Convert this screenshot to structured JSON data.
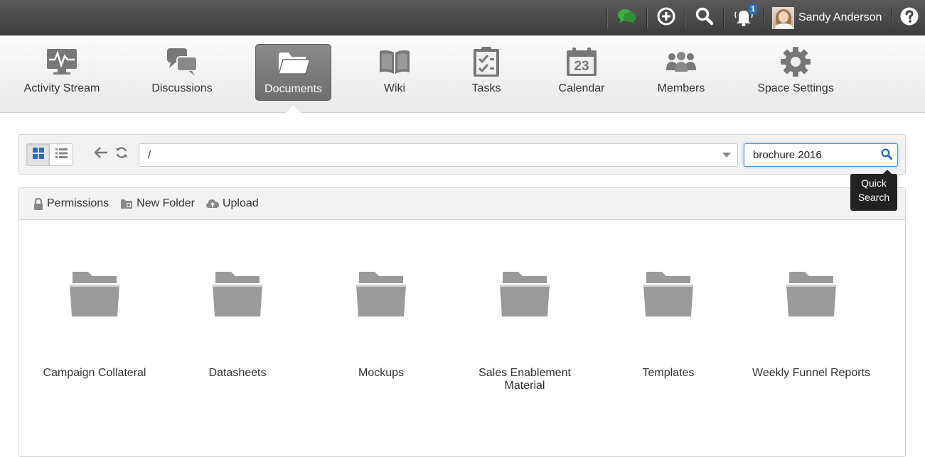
{
  "topbar": {
    "chat_icon": "chat-icon",
    "add_icon": "plus-circle-icon",
    "search_icon": "search-icon",
    "notifications_icon": "bell-icon",
    "notification_count": "1",
    "user_name": "Sandy Anderson",
    "help_icon": "help-icon"
  },
  "nav": {
    "items": [
      {
        "label": "Activity Stream",
        "icon": "activity-icon"
      },
      {
        "label": "Discussions",
        "icon": "discussions-icon"
      },
      {
        "label": "Documents",
        "icon": "documents-icon",
        "active": true
      },
      {
        "label": "Wiki",
        "icon": "wiki-icon"
      },
      {
        "label": "Tasks",
        "icon": "tasks-icon"
      },
      {
        "label": "Calendar",
        "icon": "calendar-icon",
        "calendar_day": "23"
      },
      {
        "label": "Members",
        "icon": "members-icon"
      },
      {
        "label": "Space Settings",
        "icon": "gear-icon"
      }
    ]
  },
  "toolbar": {
    "path": "/",
    "search_value": "brochure 2016",
    "tooltip": [
      "Quick",
      "Search"
    ]
  },
  "actions": {
    "permissions": "Permissions",
    "new_folder": "New Folder",
    "upload": "Upload"
  },
  "folders": [
    {
      "name": "Campaign Collateral"
    },
    {
      "name": "Datasheets"
    },
    {
      "name": "Mockups"
    },
    {
      "name": "Sales Enablement Material"
    },
    {
      "name": "Templates"
    },
    {
      "name": "Weekly Funnel Reports"
    }
  ],
  "colors": {
    "topbar": "#4a4a4a",
    "active_tab": "#7a7a7a",
    "folder": "#9a9a9a",
    "chat_green": "#3cb043",
    "badge_blue": "#2a6fb5",
    "search_focus": "#4a90d9"
  }
}
